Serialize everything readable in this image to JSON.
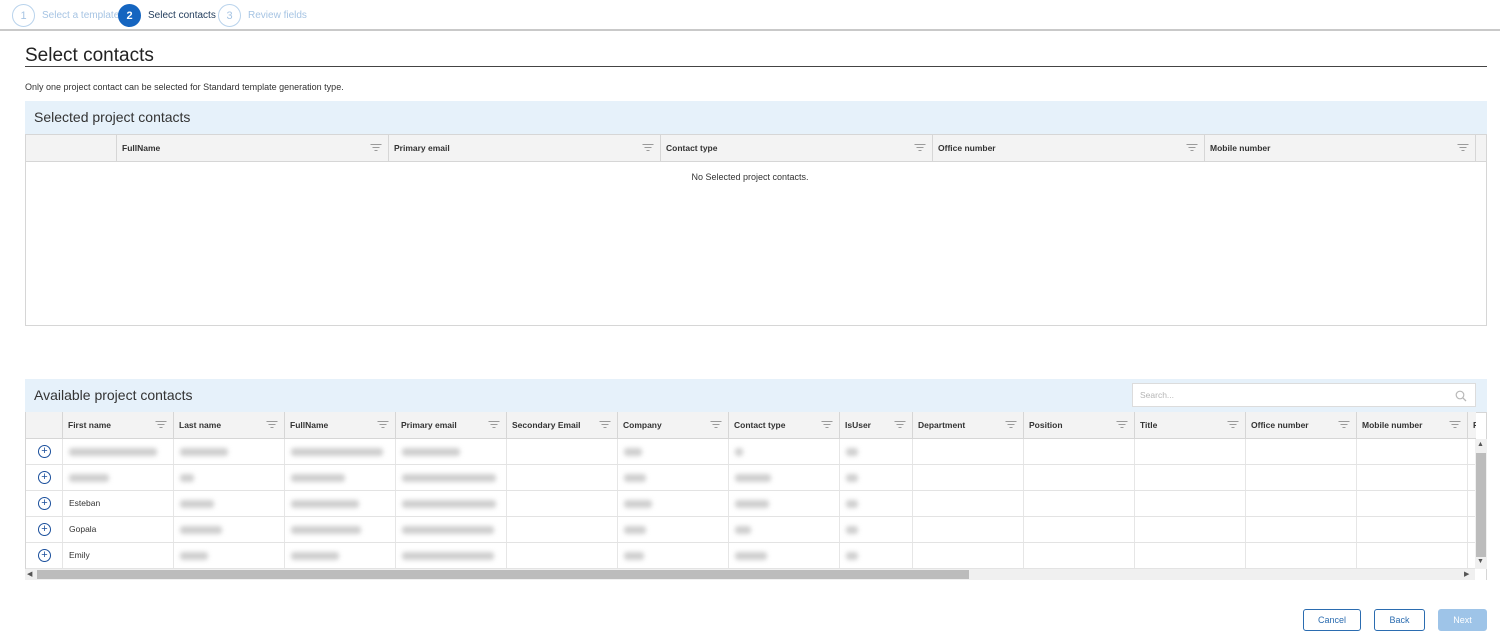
{
  "stepper": {
    "steps": [
      {
        "number": "1",
        "label": "Select a template",
        "state": "done"
      },
      {
        "number": "2",
        "label": "Select contacts",
        "state": "active"
      },
      {
        "number": "3",
        "label": "Review fields",
        "state": "pending"
      }
    ]
  },
  "page": {
    "title": "Select contacts",
    "info": "Only one project contact can be selected for Standard template generation type."
  },
  "selected_panel": {
    "title": "Selected project contacts",
    "columns": [
      "FullName",
      "Primary email",
      "Contact type",
      "Office number",
      "Mobile number"
    ],
    "empty_message": "No Selected project contacts."
  },
  "available_panel": {
    "title": "Available project contacts",
    "search_placeholder": "Search...",
    "columns": [
      "First name",
      "Last name",
      "FullName",
      "Primary email",
      "Secondary Email",
      "Company",
      "Contact type",
      "IsUser",
      "Department",
      "Position",
      "Title",
      "Office number",
      "Mobile number",
      "F"
    ],
    "rows": [
      {
        "first_name": ""
      },
      {
        "first_name": ""
      },
      {
        "first_name": "Esteban"
      },
      {
        "first_name": "Gopala"
      },
      {
        "first_name": "Emily"
      }
    ]
  },
  "footer": {
    "cancel_label": "Cancel",
    "back_label": "Back",
    "next_label": "Next"
  },
  "colors": {
    "accent": "#1565c0",
    "panel_header_bg": "#e6f1fa",
    "next_disabled": "#9ec4e8"
  },
  "icons": {
    "filter": "filter-icon",
    "search": "search-icon",
    "add": "plus-circle-icon"
  }
}
